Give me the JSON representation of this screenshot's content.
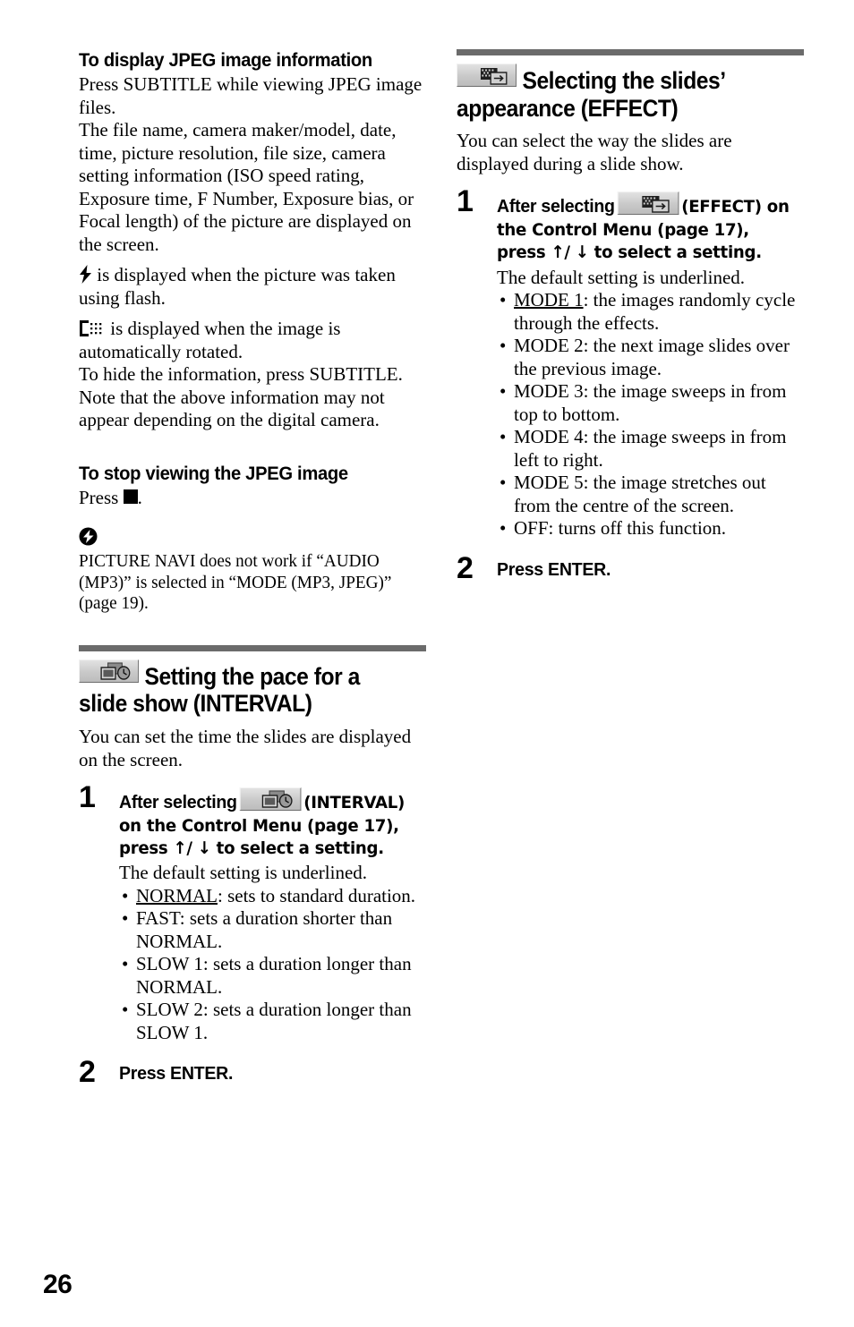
{
  "page": {
    "number": "26"
  },
  "icons": {
    "flash": "flash-icon",
    "auto_rotate": "auto-rotate-icon",
    "stop": "stop-square-icon",
    "note": "note-icon",
    "interval_chip": "interval-menu-icon",
    "effect_chip": "effect-menu-icon"
  },
  "left_column": {
    "jpeg_info": {
      "heading": "To display JPEG image information",
      "para1": "Press SUBTITLE while viewing JPEG image files.",
      "para2": "The file name, camera maker/model, date, time, picture resolution, file size, camera setting information (ISO speed rating, Exposure time, F Number, Exposure bias, or Focal length) of the picture are displayed on the screen.",
      "flash_line": "is displayed when the picture was taken using flash.",
      "rotate_line": "is displayed when the image is automatically rotated.",
      "para3": "To hide the information, press SUBTITLE. Note that the above information may not appear depending on the digital camera."
    },
    "stop_viewing": {
      "heading": "To stop viewing the JPEG image",
      "press_prefix": "Press",
      "press_suffix": "."
    },
    "note": {
      "text": "PICTURE NAVI does not work if “AUDIO (MP3)” is selected in “MODE (MP3, JPEG)” (page 19)."
    },
    "interval_section": {
      "title_part1": "Setting the pace for a",
      "title_part2": "slide show (INTERVAL)",
      "intro": "You can set the time the slides are displayed on the screen.",
      "step1": {
        "number": "1",
        "title_before_icon": "After selecting",
        "title_after_icon": "(INTERVAL) on the Control Menu (page 17), press ↑/ ↓ to select a setting.",
        "body": "The default setting is underlined.",
        "options": [
          {
            "name": "NORMAL",
            "underlined": true,
            "desc": ": sets to standard duration."
          },
          {
            "name": "FAST",
            "underlined": false,
            "desc": ": sets a duration shorter than NORMAL."
          },
          {
            "name": "SLOW 1",
            "underlined": false,
            "desc": ": sets a duration longer than NORMAL."
          },
          {
            "name": "SLOW 2",
            "underlined": false,
            "desc": ": sets a duration longer than SLOW 1."
          }
        ]
      },
      "step2": {
        "number": "2",
        "title": "Press ENTER."
      }
    }
  },
  "right_column": {
    "effect_section": {
      "title_part1": "Selecting the slides’",
      "title_part2": "appearance (EFFECT)",
      "intro": "You can select the way the slides are displayed during a slide show.",
      "step1": {
        "number": "1",
        "title_before_icon": "After selecting",
        "title_after_icon": "(EFFECT) on the Control Menu (page 17), press ↑/ ↓ to select a setting.",
        "body": "The default setting is underlined.",
        "options": [
          {
            "name": "MODE 1",
            "underlined": true,
            "desc": ": the images randomly cycle through the effects."
          },
          {
            "name": "MODE 2",
            "underlined": false,
            "desc": ": the next image slides over the previous image."
          },
          {
            "name": "MODE 3",
            "underlined": false,
            "desc": ": the image sweeps in from top to bottom."
          },
          {
            "name": "MODE 4",
            "underlined": false,
            "desc": ": the image sweeps in from left to right."
          },
          {
            "name": "MODE 5",
            "underlined": false,
            "desc": ": the image stretches out from the centre of the screen."
          },
          {
            "name": "OFF",
            "underlined": false,
            "desc": ": turns off this function."
          }
        ]
      },
      "step2": {
        "number": "2",
        "title": "Press ENTER."
      }
    }
  }
}
